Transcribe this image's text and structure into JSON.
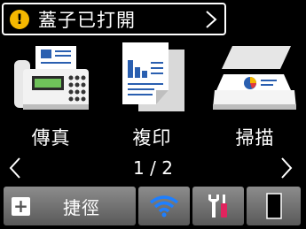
{
  "alert": {
    "icon": "warning-icon",
    "icon_glyph": "!",
    "text": "蓋子已打開",
    "icon_color": "#f5b800"
  },
  "tiles": [
    {
      "label": "傳真",
      "icon": "fax-machine-icon"
    },
    {
      "label": "複印",
      "icon": "copy-documents-icon"
    },
    {
      "label": "掃描",
      "icon": "scanner-icon"
    }
  ],
  "pager": {
    "text": "1 / 2"
  },
  "bottom_bar": {
    "shortcut_label": "捷徑",
    "shortcut_glyph": "+",
    "wifi_icon": "wifi-icon",
    "tools_icon": "tools-icon",
    "ink_icon": "ink-cartridge-icon",
    "wifi_color": "#1e7fff"
  }
}
